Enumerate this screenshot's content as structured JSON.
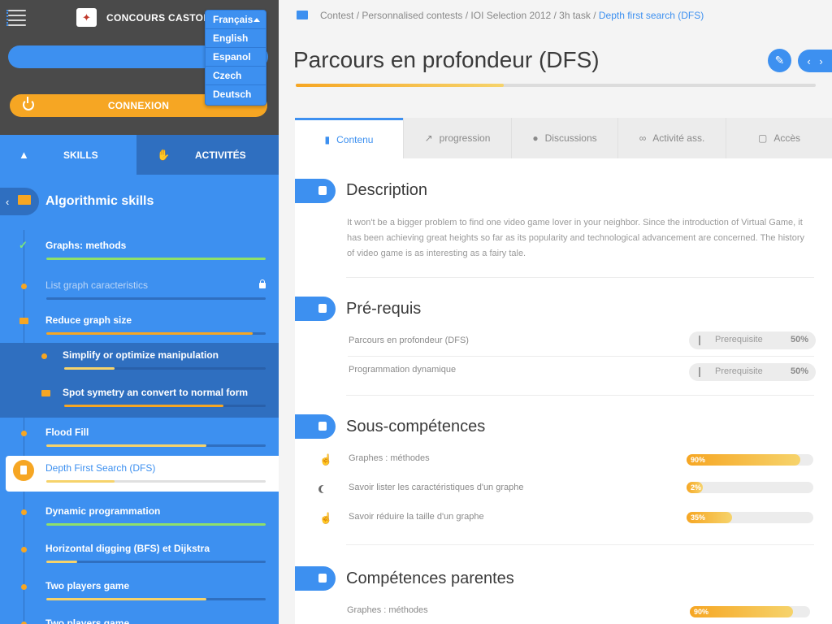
{
  "app": {
    "brand": "CONCOURS CASTOR",
    "login_label": "CONNEXION"
  },
  "languages": {
    "current": "Français",
    "options": [
      "English",
      "Espanol",
      "Czech",
      "Deutsch"
    ]
  },
  "sidebar": {
    "tabs": {
      "skills": "SKILLS",
      "activities": "ACTIVITÉS"
    },
    "title": "Algorithmic skills",
    "items": [
      {
        "label": "Graphs: methods",
        "progress": 1.0,
        "color": "#8fe06a"
      },
      {
        "label": "List graph caracteristics",
        "progress": 0,
        "color": "#f6a623"
      },
      {
        "label": "Reduce graph size",
        "progress": 0.94,
        "color": "#f6a623"
      },
      {
        "label": "Simplify or optimize manipulation",
        "progress": 0.25,
        "color": "#f6d36b"
      },
      {
        "label": "Spot symetry an convert to normal form",
        "progress": 0.79,
        "color": "#f6a623"
      },
      {
        "label": "Flood Fill",
        "progress": 0.73,
        "color": "#f6d36b"
      },
      {
        "label": "Depth First Search (DFS)",
        "progress": 0.31,
        "color": "#f6d36b"
      },
      {
        "label": "Dynamic programmation",
        "progress": 1.0,
        "color": "#8fe06a"
      },
      {
        "label": "Horizontal digging (BFS) et Dijkstra",
        "progress": 0.14,
        "color": "#f6d36b"
      },
      {
        "label": "Two players game",
        "progress": 0.73,
        "color": "#f6d36b"
      },
      {
        "label": "Two players game",
        "progress": 0,
        "color": "#f6d36b"
      }
    ]
  },
  "breadcrumb": {
    "path": "Contest / Personnalised contests / IOI Selection 2012 / 3h task / ",
    "current": "Depth first search (DFS)"
  },
  "page": {
    "title": "Parcours en profondeur (DFS)",
    "progress": 0.4
  },
  "tabs": [
    "Contenu",
    "progression",
    "Discussions",
    "Activité ass.",
    "Accès"
  ],
  "sections": {
    "description": {
      "title": "Description",
      "text": "It won't be a bigger problem to find one video game lover in your neighbor. Since the introduction of Virtual Game, it has been achieving great heights so far as its popularity and technological advancement are concerned. The history of video game is as interesting as a fairy tale."
    },
    "prereq": {
      "title": "Pré-requis",
      "rows": [
        {
          "label": "Parcours en profondeur (DFS)",
          "tag": "Prerequisite",
          "value": "50%"
        },
        {
          "label": "Programmation dynamique",
          "tag": "Prerequisite",
          "value": "50%"
        }
      ]
    },
    "subskills": {
      "title": "Sous-compétences",
      "rows": [
        {
          "label": "Graphes : méthodes",
          "value": "90%",
          "progress": 0.9,
          "icon": "thumbs-up-icon"
        },
        {
          "label": "Savoir lister les caractéristiques d'un graphe",
          "value": "2%",
          "progress": 0.13,
          "icon": "moon-icon"
        },
        {
          "label": "Savoir réduire la taille d'un graphe",
          "value": "35%",
          "progress": 0.36,
          "icon": "thumbs-up-icon"
        }
      ]
    },
    "parents": {
      "title": "Compétences parentes",
      "rows": [
        {
          "label": "Graphes : méthodes",
          "value": "90%",
          "progress": 0.86
        }
      ]
    }
  }
}
